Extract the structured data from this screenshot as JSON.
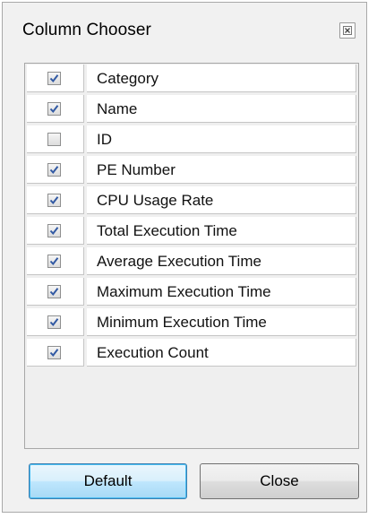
{
  "window": {
    "title": "Column Chooser",
    "close_icon": "close-icon"
  },
  "columns": [
    {
      "label": "Category",
      "checked": true
    },
    {
      "label": "Name",
      "checked": true
    },
    {
      "label": "ID",
      "checked": false
    },
    {
      "label": "PE Number",
      "checked": true
    },
    {
      "label": "CPU Usage Rate",
      "checked": true
    },
    {
      "label": "Total Execution Time",
      "checked": true
    },
    {
      "label": "Average Execution Time",
      "checked": true
    },
    {
      "label": "Maximum Execution Time",
      "checked": true
    },
    {
      "label": "Minimum Execution Time",
      "checked": true
    },
    {
      "label": "Execution Count",
      "checked": true
    }
  ],
  "buttons": {
    "default_label": "Default",
    "close_label": "Close"
  },
  "colors": {
    "checkmark": "#3159a3",
    "focus_border": "#3c7fb1"
  }
}
